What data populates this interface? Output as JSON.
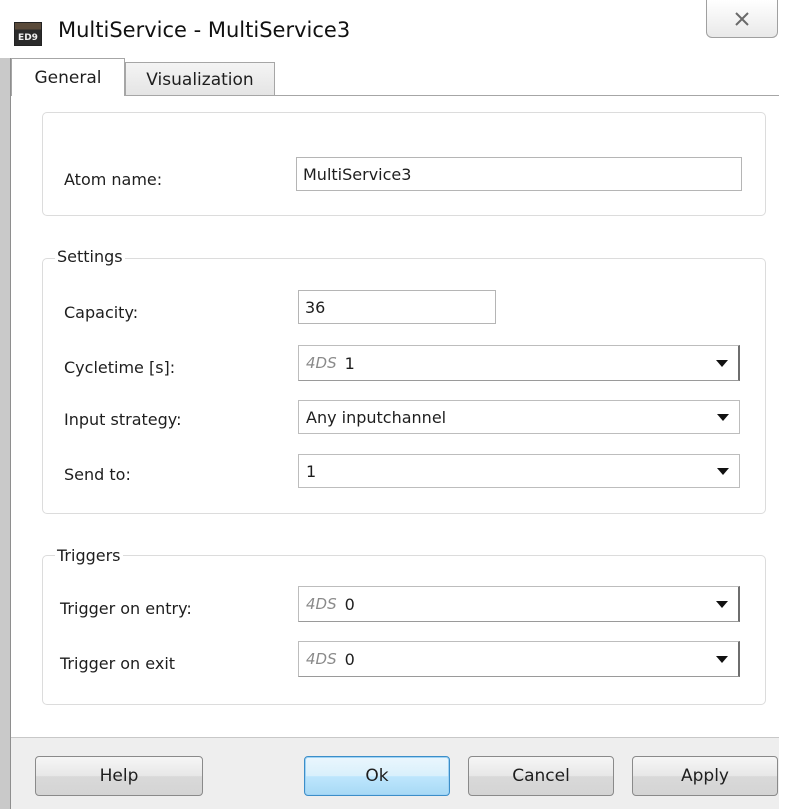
{
  "window": {
    "title": "MultiService - MultiService3",
    "icon_text": "ED9",
    "close_symbol": "✕"
  },
  "tabs": [
    {
      "label": "General",
      "active": true
    },
    {
      "label": "Visualization",
      "active": false
    }
  ],
  "atom": {
    "name_label": "Atom name:",
    "name_value": "MultiService3"
  },
  "settings": {
    "legend": "Settings",
    "capacity_label": "Capacity:",
    "capacity_value": "36",
    "cycletime_label": "Cycletime [s]:",
    "cycletime_prefix": "4DS",
    "cycletime_value": "1",
    "input_strategy_label": "Input strategy:",
    "input_strategy_value": "Any inputchannel",
    "send_to_label": "Send to:",
    "send_to_value": "1"
  },
  "triggers": {
    "legend": "Triggers",
    "entry_label": "Trigger on entry:",
    "entry_prefix": "4DS",
    "entry_value": "0",
    "exit_label": "Trigger on exit",
    "exit_prefix": "4DS",
    "exit_value": "0"
  },
  "buttons": {
    "help": "Help",
    "ok": "Ok",
    "cancel": "Cancel",
    "apply": "Apply"
  },
  "colors": {
    "ok_border": "#3c8ec8",
    "frame": "#c9c9c9",
    "button_bar": "#eeeeee"
  }
}
